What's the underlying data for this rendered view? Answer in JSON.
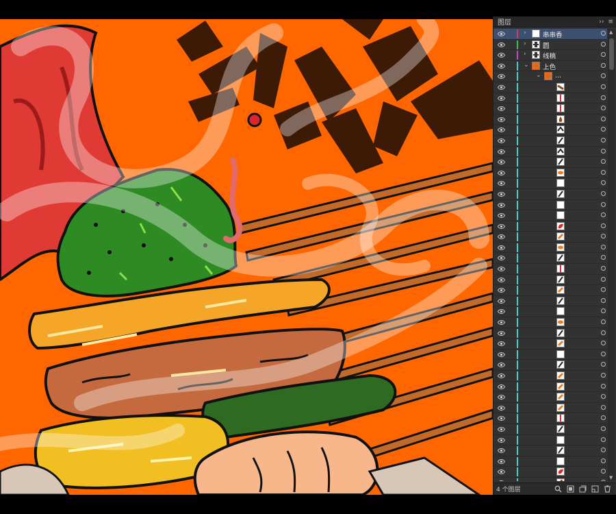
{
  "panel": {
    "title": "图层",
    "collapse_glyph": "››",
    "menu_glyph": "≡",
    "footer_count": "4 个图层",
    "scroll_up_glyph": "▲",
    "scroll_down_glyph": "▼"
  },
  "layers": [
    {
      "name": "串串香",
      "color": "#e4335a",
      "thumb": "white",
      "expanded": false,
      "selected": true
    },
    {
      "name": "圆",
      "color": "#3fbf4a",
      "thumb": "figure",
      "expanded": false,
      "selected": false
    },
    {
      "name": "线稿",
      "color": "#c447c8",
      "thumb": "figure",
      "expanded": false,
      "selected": false
    },
    {
      "name": "上色",
      "color": "#3fd2d2",
      "thumb": "orange",
      "expanded": true,
      "selected": false
    },
    {
      "name": "...",
      "color": "#3fd2d2",
      "thumb": "orange",
      "expanded": true,
      "selected": false,
      "sub": true
    }
  ],
  "sublayer_thumbs": [
    "brown-slash",
    "red-stick",
    "red-stick",
    "brown-drop",
    "dark-chevron",
    "dark-slash",
    "dark-chevron",
    "dark-slash",
    "orange-blob",
    "white",
    "dark-slash",
    "white",
    "white",
    "red-blob",
    "orange-slash",
    "orange-blob",
    "dark-slash",
    "red-stick",
    "dark-slash",
    "orange-slash",
    "dark-slash",
    "white",
    "orange-blob",
    "dark-slash",
    "orange-slash",
    "white",
    "dark-slash",
    "orange-slash",
    "orange-slash",
    "orange-slash",
    "orange-slash",
    "red-stick",
    "dark-slash",
    "white",
    "dark-slash",
    "white",
    "red-blob",
    "red-slash",
    "red-slash",
    "red-slash",
    "red-blob"
  ],
  "colors": {
    "canvas_bg": "#ff6600",
    "ink": "#111111",
    "panel_bg": "#323232",
    "selected_row": "#3e5070",
    "sublayer_bar": "#3fd2d2"
  },
  "icons": [
    "eye-icon",
    "chevron-icon",
    "target-circle-icon",
    "search-icon",
    "clip-mask-icon",
    "new-sublayer-icon",
    "new-layer-icon",
    "trash-icon"
  ]
}
